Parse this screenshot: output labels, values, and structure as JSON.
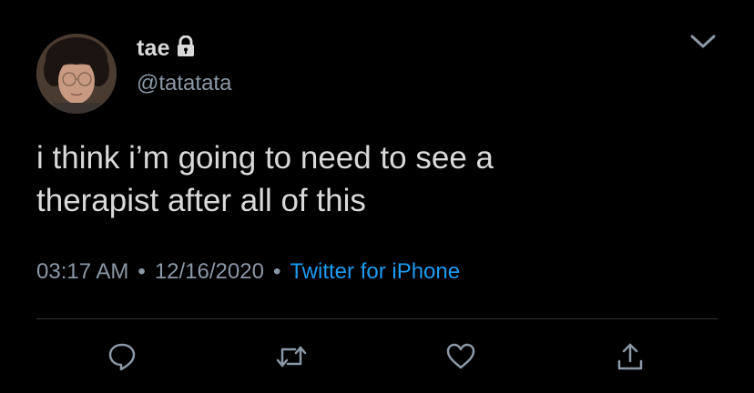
{
  "tweet": {
    "display_name": "tae",
    "handle": "@tatatata",
    "text_line1": "i think i’m going to need to see a",
    "text_line2": "therapist after all of this",
    "time": "03:17 AM",
    "separator": "•",
    "date": "12/16/2020",
    "source": "Twitter for iPhone"
  },
  "icons": {
    "lock": "lock-icon",
    "menu": "chevron-down-icon",
    "reply": "reply-icon",
    "retweet": "retweet-icon",
    "like": "heart-icon",
    "share": "share-icon"
  },
  "colors": {
    "background": "#000000",
    "text": "#d9d9d9",
    "secondary": "#8b98a5",
    "link": "#1d9bf0",
    "divider": "#2f3336"
  }
}
